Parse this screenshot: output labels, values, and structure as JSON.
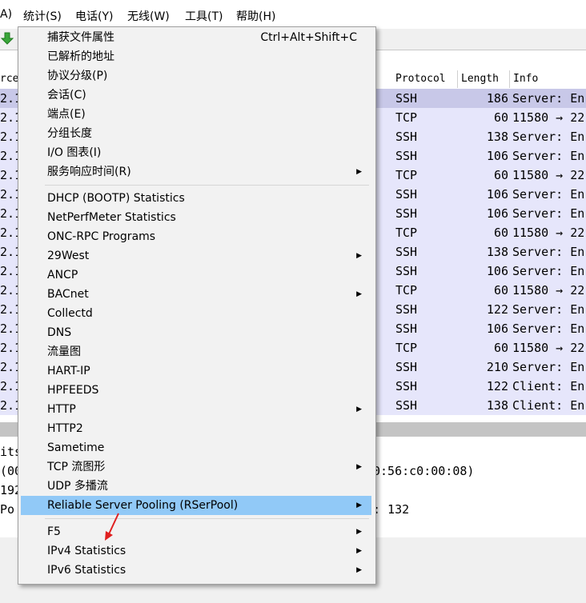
{
  "menubar": {
    "items": [
      {
        "label": "A)"
      },
      {
        "label": "统计(S)"
      },
      {
        "label": "电话(Y)"
      },
      {
        "label": "无线(W)"
      },
      {
        "label": "工具(T)"
      },
      {
        "label": "帮助(H)"
      }
    ]
  },
  "toolbar": {
    "icon": "go-down-icon",
    "icon_color": "#3aa63a"
  },
  "packet_list": {
    "columns": [
      "rce",
      "Protocol",
      "Length",
      "Info"
    ],
    "rows": [
      {
        "src": "2.1",
        "proto": "SSH",
        "len": "186",
        "info": "Server: En"
      },
      {
        "src": "2.1",
        "proto": "TCP",
        "len": "60",
        "info": "11580 → 22"
      },
      {
        "src": "2.1",
        "proto": "SSH",
        "len": "138",
        "info": "Server: En"
      },
      {
        "src": "2.1",
        "proto": "SSH",
        "len": "106",
        "info": "Server: En"
      },
      {
        "src": "2.1",
        "proto": "TCP",
        "len": "60",
        "info": "11580 → 22"
      },
      {
        "src": "2.1",
        "proto": "SSH",
        "len": "106",
        "info": "Server: En"
      },
      {
        "src": "2.1",
        "proto": "SSH",
        "len": "106",
        "info": "Server: En"
      },
      {
        "src": "2.1",
        "proto": "TCP",
        "len": "60",
        "info": "11580 → 22"
      },
      {
        "src": "2.1",
        "proto": "SSH",
        "len": "138",
        "info": "Server: En"
      },
      {
        "src": "2.1",
        "proto": "SSH",
        "len": "106",
        "info": "Server: En"
      },
      {
        "src": "2.1",
        "proto": "TCP",
        "len": "60",
        "info": "11580 → 22"
      },
      {
        "src": "2.1",
        "proto": "SSH",
        "len": "122",
        "info": "Server: En"
      },
      {
        "src": "2.1",
        "proto": "SSH",
        "len": "106",
        "info": "Server: En"
      },
      {
        "src": "2.1",
        "proto": "TCP",
        "len": "60",
        "info": "11580 → 22"
      },
      {
        "src": "2.1",
        "proto": "SSH",
        "len": "210",
        "info": "Server: En"
      },
      {
        "src": "2.1",
        "proto": "SSH",
        "len": "122",
        "info": "Client: En"
      },
      {
        "src": "2.1",
        "proto": "SSH",
        "len": "138",
        "info": "Client: En"
      }
    ]
  },
  "details": {
    "lines": [
      "its",
      "(00",
      "192",
      " Po"
    ],
    "right1": "0:56:c0:00:08)",
    "right2": ": 132"
  },
  "stats_menu": {
    "items": [
      {
        "label": "捕获文件属性",
        "shortcut": "Ctrl+Alt+Shift+C",
        "submenu": false
      },
      {
        "label": "已解析的地址",
        "shortcut": "",
        "submenu": false
      },
      {
        "label": "协议分级(P)",
        "shortcut": "",
        "submenu": false
      },
      {
        "label": "会话(C)",
        "shortcut": "",
        "submenu": false
      },
      {
        "label": "端点(E)",
        "shortcut": "",
        "submenu": false
      },
      {
        "label": "分组长度",
        "shortcut": "",
        "submenu": false
      },
      {
        "label": "I/O 图表(I)",
        "shortcut": "",
        "submenu": false
      },
      {
        "label": "服务响应时间(R)",
        "shortcut": "",
        "submenu": true
      },
      {
        "label": "DHCP (BOOTP) Statistics",
        "shortcut": "",
        "submenu": false
      },
      {
        "label": "NetPerfMeter Statistics",
        "shortcut": "",
        "submenu": false
      },
      {
        "label": "ONC-RPC Programs",
        "shortcut": "",
        "submenu": false
      },
      {
        "label": "29West",
        "shortcut": "",
        "submenu": true
      },
      {
        "label": "ANCP",
        "shortcut": "",
        "submenu": false
      },
      {
        "label": "BACnet",
        "shortcut": "",
        "submenu": true
      },
      {
        "label": "Collectd",
        "shortcut": "",
        "submenu": false
      },
      {
        "label": "DNS",
        "shortcut": "",
        "submenu": false
      },
      {
        "label": "流量图",
        "shortcut": "",
        "submenu": false
      },
      {
        "label": "HART-IP",
        "shortcut": "",
        "submenu": false
      },
      {
        "label": "HPFEEDS",
        "shortcut": "",
        "submenu": false
      },
      {
        "label": "HTTP",
        "shortcut": "",
        "submenu": true
      },
      {
        "label": "HTTP2",
        "shortcut": "",
        "submenu": false
      },
      {
        "label": "Sametime",
        "shortcut": "",
        "submenu": false
      },
      {
        "label": "TCP 流图形",
        "shortcut": "",
        "submenu": true
      },
      {
        "label": "UDP 多播流",
        "shortcut": "",
        "submenu": false
      },
      {
        "label": "Reliable Server Pooling (RSerPool)",
        "shortcut": "",
        "submenu": true
      },
      {
        "label": "F5",
        "shortcut": "",
        "submenu": true
      },
      {
        "label": "IPv4 Statistics",
        "shortcut": "",
        "submenu": true
      },
      {
        "label": "IPv6 Statistics",
        "shortcut": "",
        "submenu": true
      }
    ],
    "highlighted_label": "Reliable Server Pooling (RSerPool)",
    "submenu_glyph": "▶"
  },
  "annotation": {
    "icon": "red-arrow-icon",
    "color": "#e02020"
  },
  "colors": {
    "row_bg": "#e6e6fb",
    "highlight": "#91c9f7",
    "menu_bg": "#f2f2f2"
  }
}
